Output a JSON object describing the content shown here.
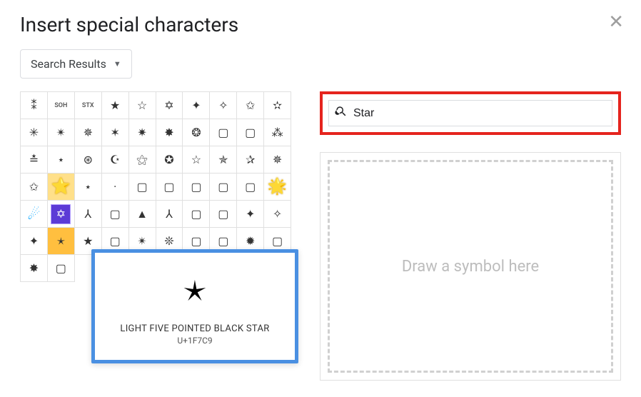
{
  "title": "Insert special characters",
  "dropdown_label": "Search Results",
  "search_value": "Star",
  "draw_placeholder": "Draw a symbol here",
  "preview": {
    "glyph": "🟉",
    "name": "LIGHT FIVE POINTED BLACK STAR",
    "code": "U+1F7C9"
  },
  "grid": [
    [
      {
        "g": "⁑"
      },
      {
        "g": "SOH",
        "small": true
      },
      {
        "g": "STX",
        "small": true
      },
      {
        "g": "★"
      },
      {
        "g": "☆"
      },
      {
        "g": "✡"
      },
      {
        "g": "✦"
      },
      {
        "g": "✧"
      },
      {
        "g": "✩"
      },
      {
        "g": "✫"
      }
    ],
    [
      {
        "g": "✳"
      },
      {
        "g": "✴"
      },
      {
        "g": "✵"
      },
      {
        "g": "✶"
      },
      {
        "g": "✷"
      },
      {
        "g": "✸"
      },
      {
        "g": "❂"
      },
      {
        "g": "▢"
      },
      {
        "g": "▢"
      },
      {
        "g": "⁂"
      }
    ],
    [
      {
        "g": "≛"
      },
      {
        "g": "⋆"
      },
      {
        "g": "⊛"
      },
      {
        "g": "☪"
      },
      {
        "g": "⚝"
      },
      {
        "g": "✪"
      },
      {
        "g": "☆"
      },
      {
        "g": "✯"
      },
      {
        "g": "✰"
      },
      {
        "g": "✵"
      }
    ],
    [
      {
        "g": "✩"
      },
      {
        "g": "⭐",
        "hl": "yellow",
        "cls": "glow"
      },
      {
        "g": "⋆"
      },
      {
        "g": "·"
      },
      {
        "g": "▢"
      },
      {
        "g": "▢"
      },
      {
        "g": "▢"
      },
      {
        "g": "▢"
      },
      {
        "g": "▢"
      },
      {
        "g": "🌟",
        "cls": "sparkly"
      }
    ],
    [
      {
        "g": "☄",
        "cls": "ball"
      },
      {
        "g": "✡",
        "cls": "badge"
      },
      {
        "g": "⅄"
      },
      {
        "g": "▢"
      },
      {
        "g": "▲"
      },
      {
        "g": "⅄"
      },
      {
        "g": "▢"
      },
      {
        "g": "▢"
      },
      {
        "g": "✦"
      },
      {
        "g": "✧"
      }
    ],
    [
      {
        "g": "✦"
      },
      {
        "g": "🟉",
        "hl": "amber"
      },
      {
        "g": "★"
      },
      {
        "g": "▢"
      },
      {
        "g": "✴"
      },
      {
        "g": "❊"
      },
      {
        "g": "▢"
      },
      {
        "g": "▢"
      },
      {
        "g": "✹"
      },
      {
        "g": "▢"
      }
    ],
    [
      {
        "g": "✸"
      },
      {
        "g": "▢"
      },
      {
        "g": ""
      },
      {
        "g": ""
      },
      {
        "g": ""
      },
      {
        "g": ""
      },
      {
        "g": ""
      },
      {
        "g": ""
      },
      {
        "g": ""
      },
      {
        "g": ""
      }
    ]
  ]
}
